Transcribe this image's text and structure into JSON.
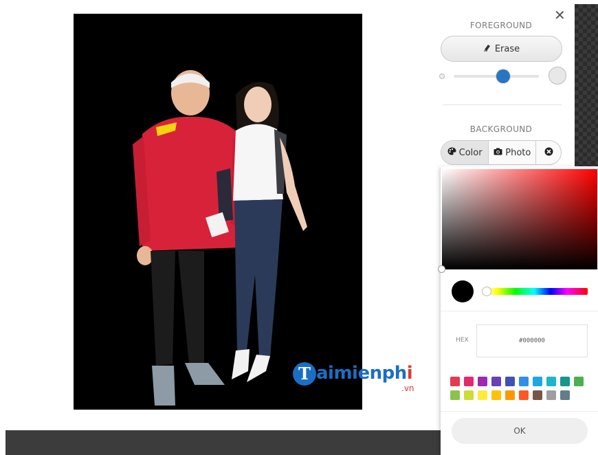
{
  "panel": {
    "close_glyph": "✕",
    "foreground_title": "FOREGROUND",
    "erase_label": "Erase",
    "erase_icon": "eraser-icon",
    "brush_size_level": 0.58,
    "background_title": "BACKGROUND",
    "tabs": [
      {
        "label": "Color",
        "icon": "palette-icon",
        "active": true
      },
      {
        "label": "Photo",
        "icon": "camera-icon",
        "active": false
      },
      {
        "label": "",
        "icon": "remove-circle-icon",
        "active": false
      }
    ]
  },
  "picker": {
    "current_color": "#000000",
    "hex_label": "HEX",
    "hex_value": "#000000",
    "swatches": [
      "#e53950",
      "#e32a6c",
      "#9c2bb1",
      "#6741b8",
      "#3f51b5",
      "#2f8fe8",
      "#1ea7e1",
      "#1ab7c9",
      "#17968a",
      "#4caf50",
      "#8bc34a",
      "#cddc39",
      "#ffeb3b",
      "#ffc107",
      "#ff9800",
      "#ff5722",
      "#795548",
      "#9e9e9e",
      "#607d8b"
    ],
    "ok_label": "OK"
  },
  "watermark": {
    "letter": "T",
    "word_blue": "aimienph",
    "word_red": "i",
    "tld": ".vn"
  }
}
